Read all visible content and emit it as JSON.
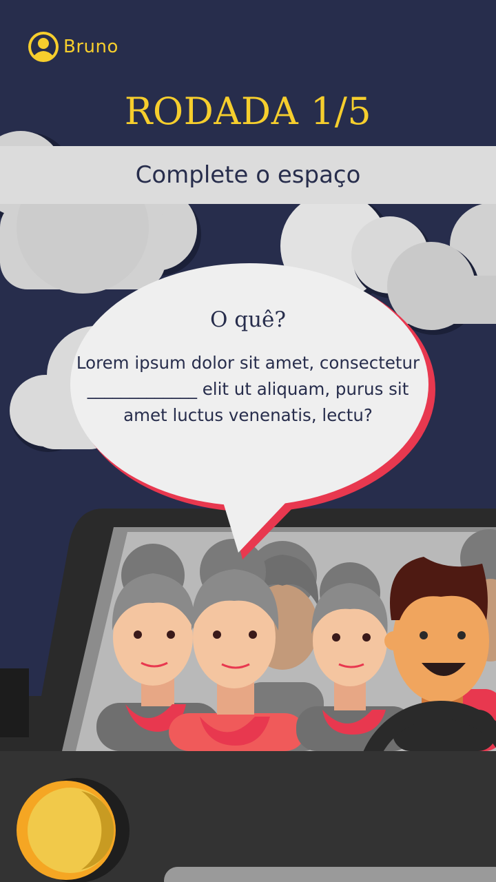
{
  "header": {
    "user_name": "Bruno",
    "avatar_icon": "user-avatar-icon"
  },
  "round": {
    "title": "RODADA 1/5",
    "current": 1,
    "total": 5
  },
  "instruction": "Complete o espaço",
  "question": {
    "label": "O quê?",
    "text": "Lorem ipsum dolor sit amet, consectetur _____________ elit ut aliquam, purus sit amet luctus venenatis, lectu?"
  },
  "colors": {
    "background": "#272d4c",
    "accent_yellow": "#f6ce2d",
    "band_gray": "#dcdcdc",
    "bubble_red": "#e8384f",
    "text_dark": "#272d4c"
  }
}
